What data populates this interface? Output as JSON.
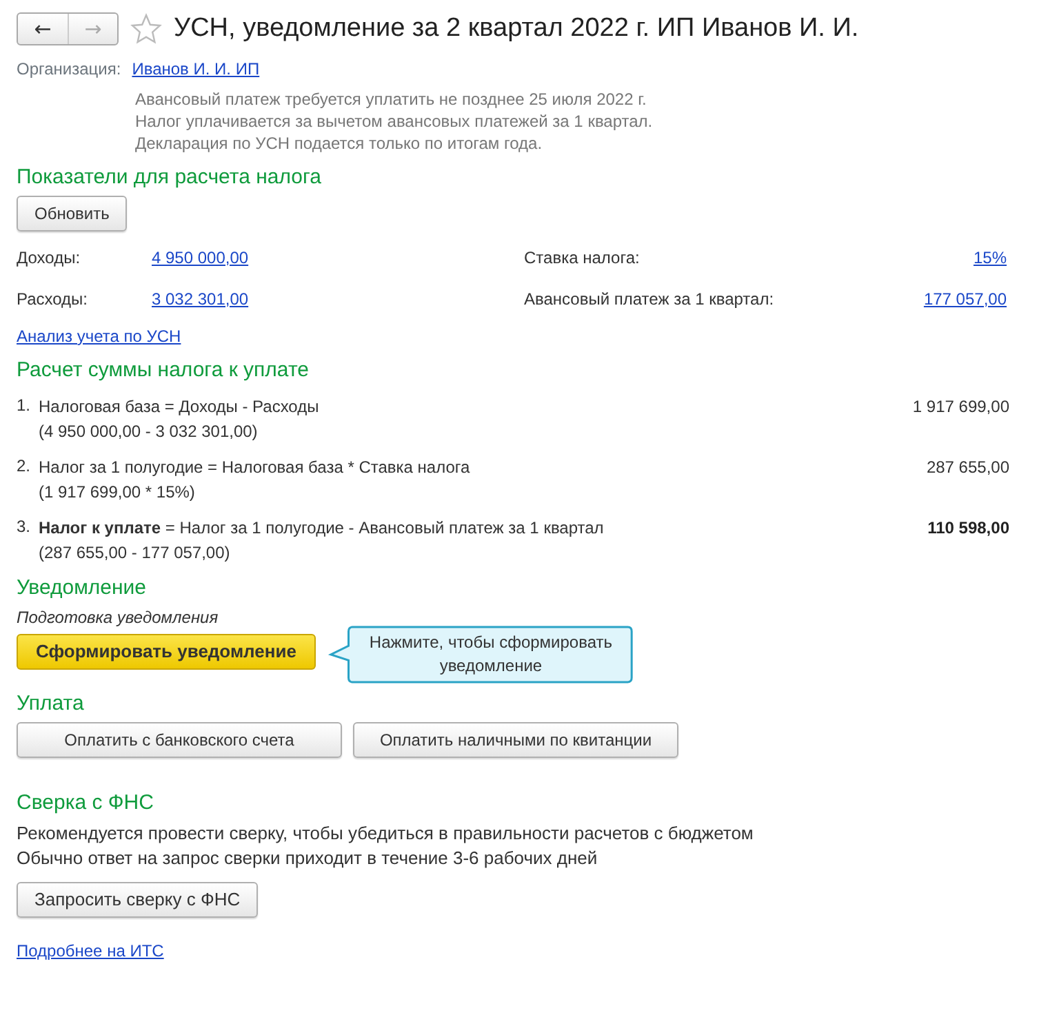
{
  "header": {
    "back": {
      "label": "←",
      "disabled": false
    },
    "forward": {
      "label": "→",
      "disabled": true
    },
    "favorite": false,
    "title": "УСН, уведомление за 2 квартал 2022 г. ИП Иванов И. И."
  },
  "organization": {
    "label": "Организация:",
    "value": "Иванов И. И. ИП"
  },
  "notes": [
    "Авансовый платеж требуется уплатить не позднее 25 июля 2022 г.",
    "Налог уплачивается за вычетом авансовых платежей за 1 квартал.",
    "Декларация по УСН подается только по итогам года."
  ],
  "indicators": {
    "heading": "Показатели для расчета налога",
    "refresh_button": "Обновить",
    "rows": [
      [
        {
          "label": "Доходы:",
          "value": "4 950 000,00"
        },
        {
          "label": "Ставка налога:",
          "value": "15%"
        }
      ],
      [
        {
          "label": "Расходы:",
          "value": "3 032 301,00"
        },
        {
          "label": "Авансовый платеж за 1 квартал:",
          "value": "177 057,00"
        }
      ]
    ],
    "analysis_link": "Анализ учета по УСН"
  },
  "calculation": {
    "heading": "Расчет суммы налога к уплате",
    "items": [
      {
        "number": "1.",
        "formula": "Налоговая база = Доходы - Расходы",
        "detail": "(4 950 000,00 - 3 032 301,00)",
        "amount": "1 917 699,00",
        "total": false
      },
      {
        "number": "2.",
        "formula": "Налог за 1 полугодие = Налоговая база * Ставка налога",
        "detail": "(1 917 699,00 * 15%)",
        "amount": "287 655,00",
        "total": false
      },
      {
        "number": "3.",
        "formula": "**Налог к уплате** = Налог за 1 полугодие - Авансовый платеж за 1 квартал",
        "detail": "(287 655,00 - 177 057,00)",
        "amount": "110 598,00",
        "total": true
      }
    ]
  },
  "notification": {
    "heading": "Уведомление",
    "status": "Подготовка уведомления",
    "button": "Сформировать уведомление",
    "tooltip": "Нажмите, чтобы сформировать уведомление"
  },
  "payment": {
    "heading": "Уплата",
    "buttons": [
      "Оплатить с банковского счета",
      "Оплатить наличными по квитанции"
    ]
  },
  "reconciliation": {
    "heading": "Сверка с ФНС",
    "text": [
      "Рекомендуется провести сверку, чтобы убедиться в правильности расчетов с бюджетом",
      "Обычно ответ на запрос сверки приходит в течение 3-6 рабочих дней"
    ],
    "button": "Запросить сверку с ФНС"
  },
  "more_link": "Подробнее на ИТС"
}
